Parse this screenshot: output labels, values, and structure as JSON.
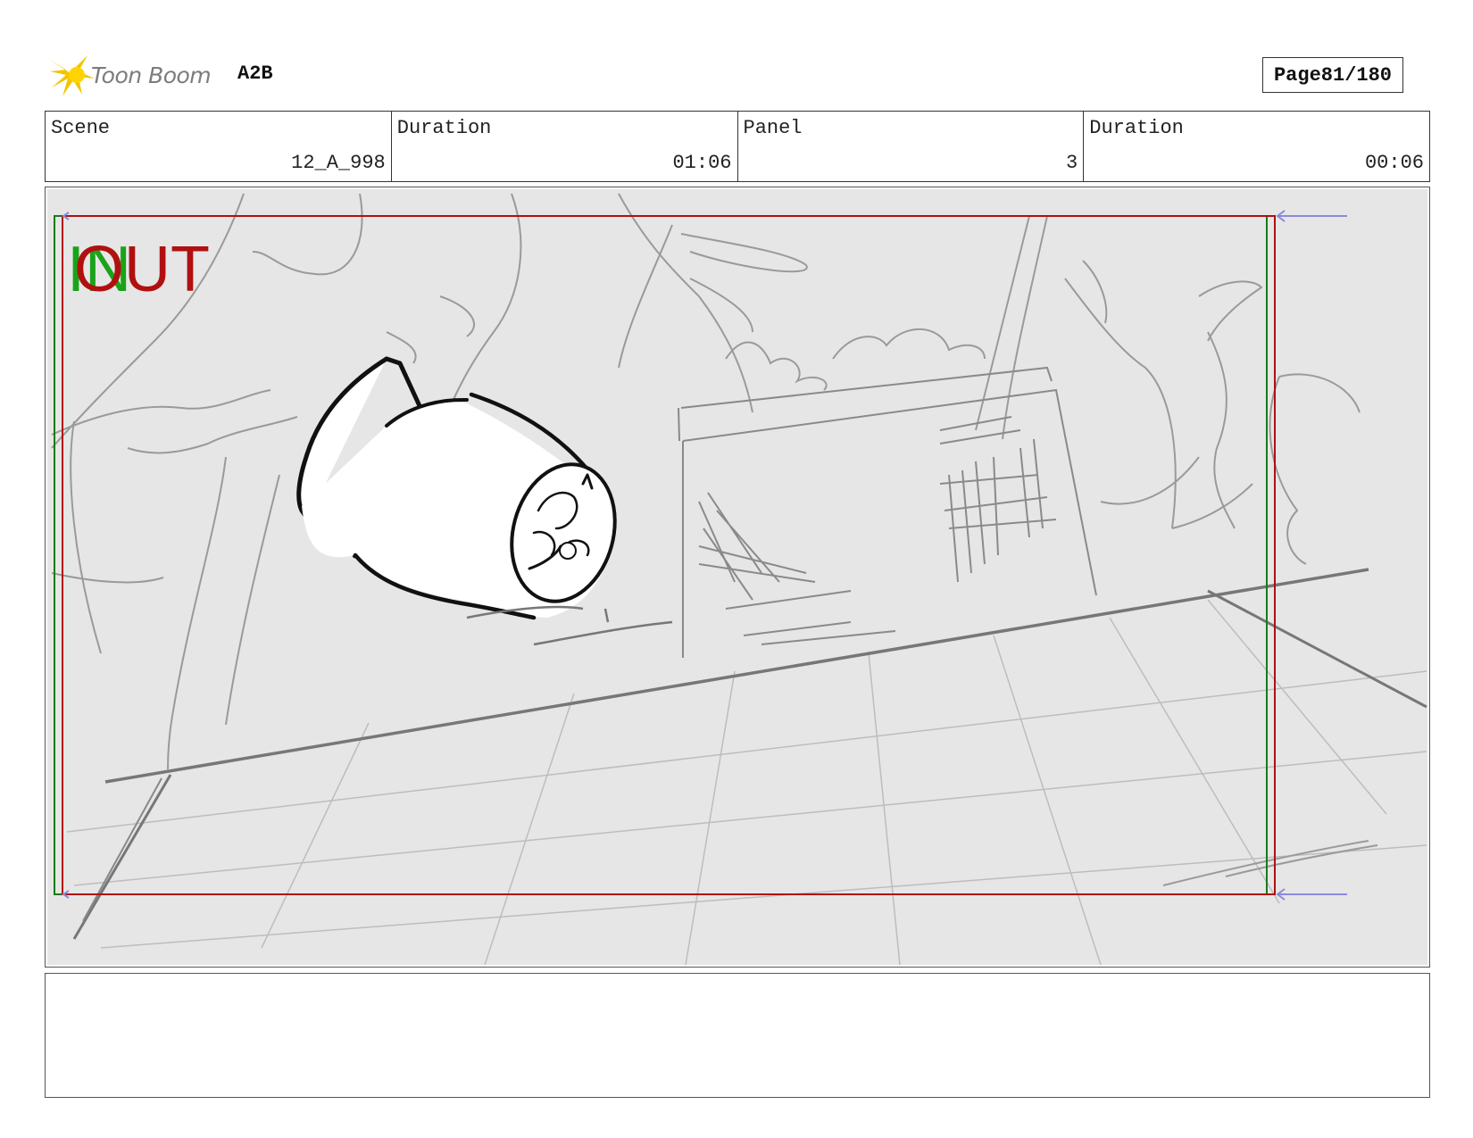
{
  "header": {
    "logo_text": "Toon Boom",
    "project": "A2B",
    "page_label": "Page",
    "page_number": "81/180"
  },
  "info": {
    "scene_label": "Scene",
    "scene_value": "12_A_998",
    "scene_duration_label": "Duration",
    "scene_duration_value": "01:06",
    "panel_label": "Panel",
    "panel_value": "3",
    "panel_duration_label": "Duration",
    "panel_duration_value": "00:06"
  },
  "frame_markers": {
    "in_text": "IN",
    "out_text": "OUT"
  },
  "colors": {
    "in_marker": "#1aa31a",
    "out_marker": "#b01010",
    "safe_arrow": "#8a8ae0",
    "panel_bg": "#e6e6e6",
    "logo_star": "#f5c400"
  },
  "notes": ""
}
